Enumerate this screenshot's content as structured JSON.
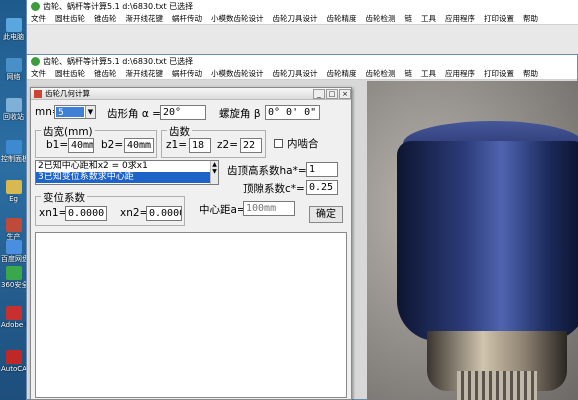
{
  "desktop": {
    "icons": [
      {
        "label": "此电脑",
        "color": "#5aa7e0"
      },
      {
        "label": "网络",
        "color": "#4a90c8"
      },
      {
        "label": "回收站",
        "color": "#7fb0d8"
      },
      {
        "label": "控制面板",
        "color": "#3d8ad0"
      },
      {
        "label": "Eg",
        "color": "#d8b850"
      },
      {
        "label": "生产",
        "color": "#c04a3a"
      },
      {
        "label": "百度网盘",
        "color": "#4a8ee0"
      },
      {
        "label": "360安全",
        "color": "#3aa84a"
      },
      {
        "label": "Adobe Reader",
        "color": "#c83030"
      },
      {
        "label": "AutoCAD",
        "color": "#c02828"
      }
    ]
  },
  "back_window": {
    "title": "齿轮、蜗杆等计算5.1   d:\\6830.txt 已选择",
    "menu": [
      "文件",
      "圆柱齿轮",
      "锥齿轮",
      "渐开线花键",
      "蜗杆传动",
      "小模数齿轮设计",
      "齿轮刀具设计",
      "齿轮精度",
      "齿轮检测",
      "链",
      "工具",
      "应用程序",
      "打印设置",
      "帮助"
    ]
  },
  "main_window": {
    "title": "齿轮、蜗杆等计算5.1   d:\\6830.txt 已选择",
    "menu": [
      "文件",
      "圆柱齿轮",
      "锥齿轮",
      "渐开线花键",
      "蜗杆传动",
      "小模数齿轮设计",
      "齿轮刀具设计",
      "齿轮精度",
      "齿轮检测",
      "链",
      "工具",
      "应用程序",
      "打印设置",
      "帮助"
    ]
  },
  "dialog": {
    "title": "齿轮几何计算",
    "module_label": "mn=",
    "module_value": "5",
    "pressure_angle_label": "齿形角 α =",
    "pressure_angle_value": "20°",
    "helix_angle_label": "螺旋角 β =",
    "helix_angle_value": "0° 0' 0\"",
    "face_width_group": "齿宽(mm)",
    "b1_label": "b1=",
    "b1_value": "40mm",
    "b2_label": "b2=",
    "b2_value": "40mm",
    "teeth_group": "齿数",
    "z1_label": "z1=",
    "z1_value": "18",
    "z2_label": "z2=",
    "z2_value": "22",
    "internal_gear_label": "内啮合",
    "internal_gear_checked": false,
    "mode_options": [
      "2已知中心距和x2 = 0求x1",
      "3已知变位系数求中心距"
    ],
    "mode_selected": 1,
    "addendum_label": "齿顶高系数ha*=",
    "addendum_value": "1",
    "clearance_label": "顶隙系数c*=",
    "clearance_value": "0.25",
    "shift_group": "变位系数",
    "xn1_label": "xn1=",
    "xn1_value": "0.0000",
    "xn2_label": "xn2=",
    "xn2_value": "0.0000",
    "center_distance_label": "中心距a=",
    "center_distance_placeholder": "100mm",
    "ok_label": "确定",
    "close_glyph": "×",
    "maximize_glyph": "□",
    "minimize_glyph": "_"
  }
}
